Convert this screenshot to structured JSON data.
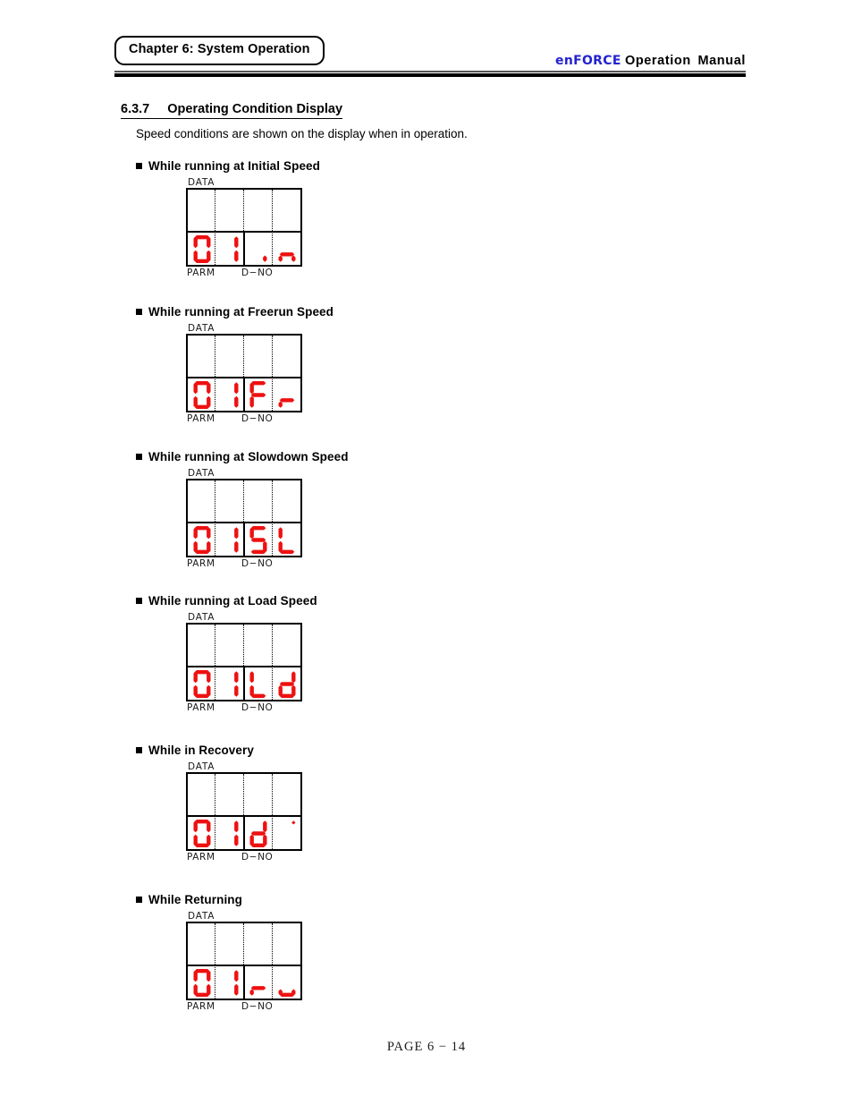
{
  "header": {
    "chapter_label": "Chapter 6: System Operation",
    "brand": "enFORCE",
    "manual_title": "Operation  Manual",
    "brand_color": "#2323cf"
  },
  "section": {
    "number": "6.3.7",
    "title": "Operating Condition Display",
    "intro": "Speed conditions are shown on the display when in operation."
  },
  "panel_labels": {
    "top": "DATA",
    "bottom_left": "PARM",
    "bottom_right": "D−NO",
    "segment_color": "#ee1111"
  },
  "blocks": [
    {
      "label": "While running at Initial Speed",
      "display": "01in",
      "chars": [
        "0",
        "1",
        "i",
        "n"
      ]
    },
    {
      "label": "While running at Freerun Speed",
      "display": "01Fr",
      "chars": [
        "0",
        "1",
        "F",
        "r"
      ]
    },
    {
      "label": "While running at Slowdown Speed",
      "display": "01SL",
      "chars": [
        "0",
        "1",
        "S",
        "L"
      ]
    },
    {
      "label": "While running at Load Speed",
      "display": "01Ld",
      "chars": [
        "0",
        "1",
        "L",
        "d"
      ]
    },
    {
      "label": "While in Recovery",
      "display": "01d'",
      "chars": [
        "0",
        "1",
        "d",
        "'"
      ]
    },
    {
      "label": "While Returning",
      "display": "01ru",
      "chars": [
        "0",
        "1",
        "r",
        "u"
      ]
    }
  ],
  "footer": {
    "page": "PAGE  6 − 14"
  }
}
